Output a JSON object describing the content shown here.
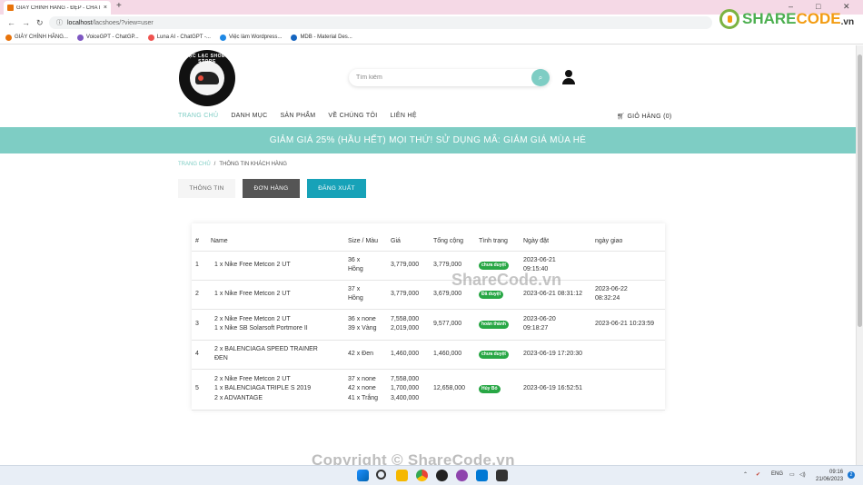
{
  "browser": {
    "tab_title": "GIÀY CHÍNH HÃNG - ĐẸP - CHẤT",
    "tab_close": "×",
    "new_tab": "+",
    "url_host": "localhost",
    "url_path": "/lacshoes/?view=user",
    "bookmarks": [
      {
        "label": "GIÀY CHÍNH HÃNG...",
        "color": "#e8730a"
      },
      {
        "label": "VoiceGPT - ChatGP...",
        "color": "#7e57c2"
      },
      {
        "label": "Luna AI - ChatGPT -...",
        "color": "#ef5350"
      },
      {
        "label": "Việc làm Wordpress...",
        "color": "#1e88e5"
      },
      {
        "label": "MDB - Material Des...",
        "color": "#1565c0"
      }
    ]
  },
  "watermark": {
    "logo_share": "SHARE",
    "logo_code": "CODE",
    "logo_vn": ".vn",
    "center": "ShareCode.vn",
    "copyright": "Copyright © ShareCode.vn"
  },
  "store": {
    "logo_text": "LẠC LẠC SHOES STORE"
  },
  "search": {
    "placeholder": "Tìm kiếm"
  },
  "nav": {
    "items": [
      "TRANG CHỦ",
      "DANH MỤC",
      "SẢN PHẨM",
      "VỀ CHÚNG TÔI",
      "LIÊN HỆ"
    ],
    "cart": "GIỎ HÀNG (0)"
  },
  "promo": "GIẢM GIÁ 25% (HẦU HẾT) MỌI THỨ! SỬ DỤNG MÃ: GIẢM GIÁ MÙA HÈ",
  "breadcrumb": {
    "home": "TRANG CHỦ",
    "sep": "/",
    "current": "THÔNG TIN KHÁCH HÀNG"
  },
  "account_tabs": {
    "info": "THÔNG TIN",
    "orders": "ĐƠN HÀNG",
    "logout": "ĐĂNG XUẤT"
  },
  "orders": {
    "headers": [
      "#",
      "Name",
      "Size / Màu",
      "Giá",
      "Tổng cộng",
      "Tình trạng",
      "Ngày đặt",
      "ngày giao"
    ],
    "rows": [
      {
        "no": "1",
        "name": [
          "1 x Nike Free Metcon 2 UT"
        ],
        "size": [
          "36 x",
          "Hồng"
        ],
        "price": [
          "3,779,000"
        ],
        "total": "3,779,000",
        "status": "chưa duyệt",
        "ordered": [
          "2023-06-21",
          "09:15:40"
        ],
        "delivered": [
          ""
        ]
      },
      {
        "no": "2",
        "name": [
          "1 x Nike Free Metcon 2 UT"
        ],
        "size": [
          "37 x",
          "Hồng"
        ],
        "price": [
          "3,779,000"
        ],
        "total": "3,679,000",
        "status": "Đã duyệt",
        "ordered": [
          "2023-06-21 08:31:12"
        ],
        "delivered": [
          "2023-06-22",
          "08:32:24"
        ]
      },
      {
        "no": "3",
        "name": [
          "2 x Nike Free Metcon 2 UT",
          "1 x Nike SB Solarsoft Portmore II"
        ],
        "size": [
          "36 x none",
          "39 x Vàng"
        ],
        "price": [
          "7,558,000",
          "2,019,000"
        ],
        "total": "9,577,000",
        "status": "hoàn thành",
        "ordered": [
          "2023-06-20",
          "09:18:27"
        ],
        "delivered": [
          "2023-06-21 10:23:59"
        ]
      },
      {
        "no": "4",
        "name": [
          "2 x BALENCIAGA SPEED TRAINER",
          "ĐEN"
        ],
        "size": [
          "42 x Đen"
        ],
        "price": [
          "1,460,000"
        ],
        "total": "1,460,000",
        "status": "chưa duyệt",
        "ordered": [
          "2023-06-19 17:20:30"
        ],
        "delivered": [
          ""
        ]
      },
      {
        "no": "5",
        "name": [
          "2 x Nike Free Metcon 2 UT",
          "1 x BALENCIAGA TRIPLE S 2019",
          "2 x ADVANTAGE"
        ],
        "size": [
          "37 x none",
          "42 x none",
          "41 x Trắng"
        ],
        "price": [
          "7,558,000",
          "1,700,000",
          "3,400,000"
        ],
        "total": "12,658,000",
        "status": "Hủy Bỏ",
        "ordered": [
          "2023-06-19 16:52:51"
        ],
        "delivered": [
          ""
        ]
      }
    ]
  },
  "taskbar": {
    "lang": "ENG",
    "time": "09:16",
    "date": "21/06/2023"
  },
  "colors": {
    "accent": "#7ecdc4",
    "status_badge": "#28a745",
    "logout_btn": "#17a2b8"
  }
}
